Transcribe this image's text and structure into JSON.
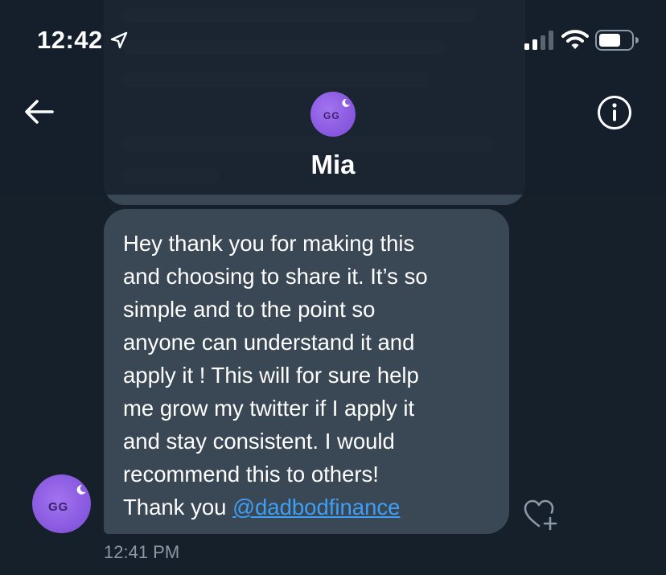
{
  "status_bar": {
    "time": "12:42",
    "icons": [
      "location-arrow-icon",
      "signal-icon",
      "wifi-icon",
      "battery-icon"
    ]
  },
  "header": {
    "contact_name": "Mia",
    "avatar_initials": "GG",
    "icons": [
      "back-arrow-icon",
      "info-icon"
    ]
  },
  "message": {
    "text_lines": [
      "Hey thank you for making this",
      "and choosing to share it. It’s so",
      "simple and to the point so",
      "anyone can understand it and",
      "apply it ! This will for sure help",
      "me grow my twitter if I apply it",
      "and stay consistent. I would",
      "recommend this to others!"
    ],
    "closing_prefix": "Thank you ",
    "mention": "@dadbodfinance",
    "timestamp": "12:41 PM",
    "sender_initials": "GG"
  },
  "colors": {
    "background": "#15202b",
    "bubble": "#3a4754",
    "link": "#3d9ff5",
    "secondary_text": "#8b98a5",
    "avatar": "#8a5ae0"
  }
}
